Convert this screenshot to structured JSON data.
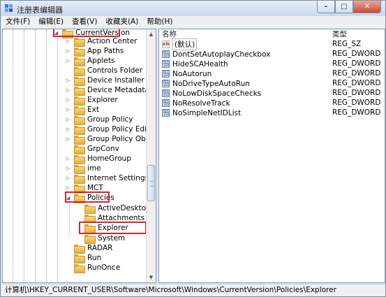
{
  "window": {
    "title": "注册表编辑器",
    "controls": {
      "minimize": "–",
      "maximize": "□",
      "close": "✕"
    }
  },
  "menu": [
    "文件(F)",
    "编辑(E)",
    "查看(V)",
    "收藏夹(A)",
    "帮助(H)"
  ],
  "tree": {
    "current_version": "CurrentVersion",
    "children": [
      "Action Center",
      "App Paths",
      "Applets",
      "Controls Folder",
      "Device Installer",
      "Device Metadata",
      "Explorer",
      "Ext",
      "Group Policy",
      "Group Policy Editor",
      "Group Policy Objects",
      "GrpConv",
      "HomeGroup",
      "ime",
      "Internet Settings",
      "MCT",
      "Policies"
    ],
    "policies_children": [
      "ActiveDesktop",
      "Attachments",
      "Explorer",
      "System"
    ],
    "after_policies": [
      "RADAR",
      "Run",
      "RunOnce"
    ],
    "highlight_color": "#d8242a"
  },
  "list": {
    "columns": {
      "name": "名称",
      "type": "类型"
    },
    "rows": [
      {
        "icon": "string-value-icon",
        "name": "(默认)",
        "type": "REG_SZ"
      },
      {
        "icon": "binary-value-icon",
        "name": "DontSetAutoplayCheckbox",
        "type": "REG_DWORD"
      },
      {
        "icon": "binary-value-icon",
        "name": "HideSCAHealth",
        "type": "REG_DWORD"
      },
      {
        "icon": "binary-value-icon",
        "name": "NoAutorun",
        "type": "REG_DWORD"
      },
      {
        "icon": "binary-value-icon",
        "name": "NoDriveTypeAutoRun",
        "type": "REG_DWORD"
      },
      {
        "icon": "binary-value-icon",
        "name": "NoLowDiskSpaceChecks",
        "type": "REG_DWORD"
      },
      {
        "icon": "binary-value-icon",
        "name": "NoResolveTrack",
        "type": "REG_DWORD"
      },
      {
        "icon": "binary-value-icon",
        "name": "NoSimpleNetIDList",
        "type": "REG_DWORD"
      }
    ]
  },
  "status_path": "计算机\\HKEY_CURRENT_USER\\Software\\Microsoft\\Windows\\CurrentVersion\\Policies\\Explorer"
}
